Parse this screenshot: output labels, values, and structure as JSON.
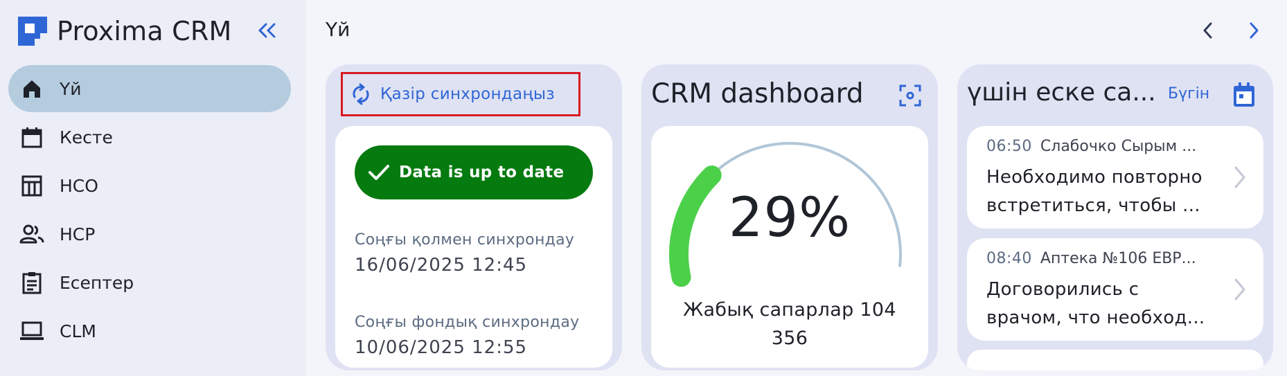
{
  "app": {
    "title": "Proxima CRM"
  },
  "colors": {
    "accent": "#2f66d6",
    "active_nav": "#b5ccdf",
    "status_ok": "#057a0f",
    "gauge_fill": "#4cd04a",
    "gauge_track": "#b0c6d8",
    "highlight_border": "#d71920"
  },
  "sidebar": {
    "items": [
      {
        "label": "Үй",
        "icon": "home-icon",
        "active": true
      },
      {
        "label": "Кесте",
        "icon": "calendar-icon"
      },
      {
        "label": "HCO",
        "icon": "building-icon"
      },
      {
        "label": "HCP",
        "icon": "people-icon"
      },
      {
        "label": "Есептер",
        "icon": "clipboard-icon"
      },
      {
        "label": "CLM",
        "icon": "laptop-icon"
      }
    ]
  },
  "header": {
    "title": "Үй"
  },
  "sync_card": {
    "sync_button": "Қазір синхрондаңыз",
    "status": "Data is up to date",
    "last_manual_label": "Соңғы қолмен синхрондау",
    "last_manual_value": "16/06/2025 12:45",
    "last_background_label": "Соңғы фондық синхрондау",
    "last_background_value": "10/06/2025 12:55"
  },
  "dashboard_card": {
    "title": "CRM dashboard",
    "gauge_percent": 29,
    "gauge_label": "29%",
    "caption": "Жабық сапарлар 104 356"
  },
  "reminders_card": {
    "title": "үшін еске са...",
    "today_link": "Бүгін",
    "items": [
      {
        "time": "06:50",
        "subject": "Слабочко Сырым ...",
        "line1": "Необходимо повторно",
        "line2": "встретиться, чтобы ..."
      },
      {
        "time": "08:40",
        "subject": "Аптека №106 ЕВР...",
        "line1": "Договорились с",
        "line2": "врачом, что необход..."
      }
    ]
  }
}
